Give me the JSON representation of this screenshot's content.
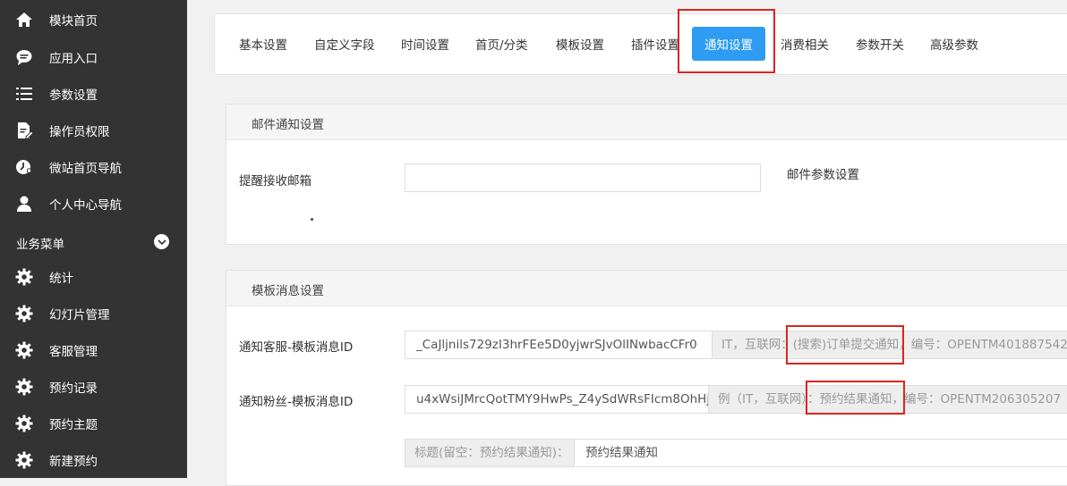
{
  "sidebar": {
    "items": [
      {
        "label": "模块首页",
        "icon": "home-icon"
      },
      {
        "label": "应用入口",
        "icon": "chat-bubble-icon"
      },
      {
        "label": "参数设置",
        "icon": "list-settings-icon"
      },
      {
        "label": "操作员权限",
        "icon": "edit-document-icon"
      },
      {
        "label": "微站首页导航",
        "icon": "clock-person-icon"
      },
      {
        "label": "个人中心导航",
        "icon": "user-icon"
      }
    ],
    "section": {
      "label": "业务菜单",
      "icon": "chevron-down-icon"
    },
    "business_items": [
      {
        "label": "统计",
        "icon": "gear-icon"
      },
      {
        "label": "幻灯片管理",
        "icon": "gear-icon"
      },
      {
        "label": "客服管理",
        "icon": "gear-icon"
      },
      {
        "label": "预约记录",
        "icon": "gear-icon"
      },
      {
        "label": "预约主题",
        "icon": "gear-icon"
      },
      {
        "label": "新建预约",
        "icon": "gear-icon"
      }
    ]
  },
  "tabs": [
    {
      "label": "基本设置",
      "active": false
    },
    {
      "label": "自定义字段",
      "active": false
    },
    {
      "label": "时间设置",
      "active": false
    },
    {
      "label": "首页/分类",
      "active": false
    },
    {
      "label": "模板设置",
      "active": false
    },
    {
      "label": "插件设置",
      "active": false
    },
    {
      "label": "通知设置",
      "active": true
    },
    {
      "label": "消费相关",
      "active": false
    },
    {
      "label": "参数开关",
      "active": false
    },
    {
      "label": "高级参数",
      "active": false
    }
  ],
  "email_panel": {
    "title": "邮件通知设置",
    "field_label": "提醒接收邮箱",
    "field_value": "",
    "link_label": "邮件参数设置"
  },
  "template_panel": {
    "title": "模板消息设置",
    "rows": [
      {
        "label": "通知客服-模板消息ID",
        "value": "_CaJljnils729zI3hrFEe5D0yjwrSJvOlINwbacCFr0",
        "hint": "IT，互联网：(搜索)订单提交通知，编号：OPENTM401887542"
      },
      {
        "label": "通知粉丝-模板消息ID",
        "value": "u4xWsiJMrcQotTMY9HwPs_Z4ySdWRsFIcm8OhHj",
        "hint": "例（IT，互联网）：预约结果通知，编号：OPENTM206305207"
      }
    ],
    "title_row": {
      "addon": "标题(留空：预约结果通知)：",
      "value": "预约结果通知"
    }
  },
  "colors": {
    "sidebar_bg": "#333333",
    "active_tab_bg": "#2d9cf2",
    "highlight_border": "#d9251f"
  }
}
